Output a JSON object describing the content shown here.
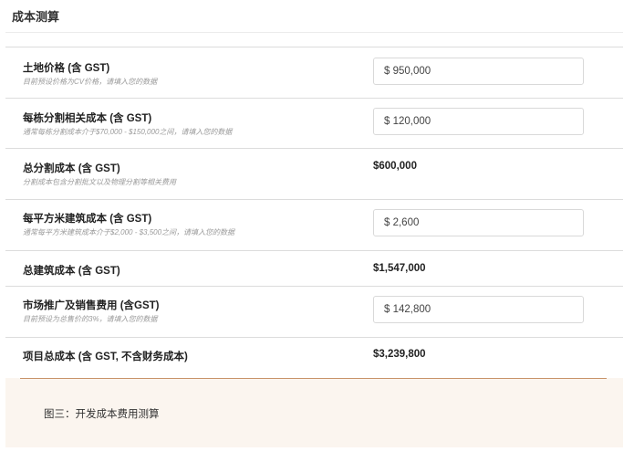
{
  "page": {
    "title": "成本测算"
  },
  "rows": [
    {
      "label": "土地价格 (含 GST)",
      "hint": "目前预设价格为CV价格，请填入您的数据",
      "value": "$ 950,000",
      "type": "input"
    },
    {
      "label": "每栋分割相关成本 (含 GST)",
      "hint": "通常每栋分割成本介于$70,000 - $150,000之间，请填入您的数据",
      "value": "$ 120,000",
      "type": "input"
    },
    {
      "label": "总分割成本 (含 GST)",
      "hint": "分割成本包含分割批文以及物理分割等相关费用",
      "value": "$600,000",
      "type": "static"
    },
    {
      "label": "每平方米建筑成本 (含 GST)",
      "hint": "通常每平方米建筑成本介于$2,000 - $3,500之间，请填入您的数据",
      "value": "$ 2,600",
      "type": "input"
    },
    {
      "label": "总建筑成本 (含 GST)",
      "hint": "",
      "value": "$1,547,000",
      "type": "static"
    },
    {
      "label": "市场推广及销售费用 (含GST)",
      "hint": "目前预设为总售价的3%，请填入您的数据",
      "value": "$ 142,800",
      "type": "input"
    },
    {
      "label": "项目总成本 (含 GST, 不含财务成本)",
      "hint": "",
      "value": "$3,239,800",
      "type": "static"
    }
  ],
  "caption": {
    "text": "图三：开发成本费用测算"
  },
  "colors": {
    "accent_line": "#c8946a",
    "caption_background": "#fbf5ef"
  }
}
